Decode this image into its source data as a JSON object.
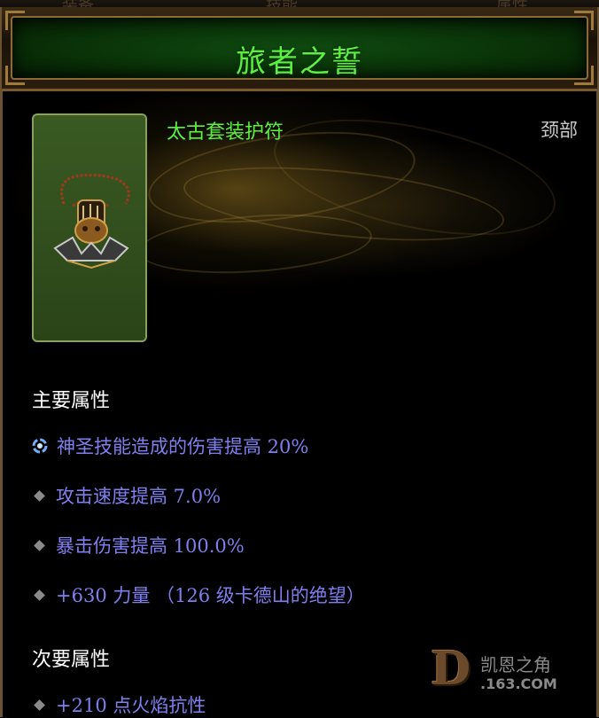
{
  "header": {
    "title": "旅者之誓",
    "tab_fragments": [
      "装备",
      "技能",
      "属性"
    ]
  },
  "item": {
    "type": "太古套装护符",
    "slot": "颈部",
    "icon": "amulet-icon"
  },
  "primary": {
    "title": "主要属性",
    "stats": [
      {
        "text": "神圣技能造成的伤害提高 20%",
        "icon": "holy-skill-icon"
      },
      {
        "text": "攻击速度提高 7.0%",
        "icon": "bullet-icon"
      },
      {
        "text": "暴击伤害提高 100.0%",
        "icon": "bullet-icon"
      },
      {
        "text": "+630 力量 （126 级卡德山的绝望）",
        "icon": "bullet-icon"
      }
    ]
  },
  "secondary": {
    "title": "次要属性",
    "stats": [
      {
        "text": "+210 点火焰抗性",
        "icon": "bullet-icon"
      }
    ]
  },
  "watermark": {
    "logo": "D",
    "name": "凯恩之角",
    "site": ".163.COM"
  },
  "colors": {
    "title_green": "#5cf040",
    "stat_blue": "#7f7ff0",
    "frame_gold": "#8a6a36"
  }
}
